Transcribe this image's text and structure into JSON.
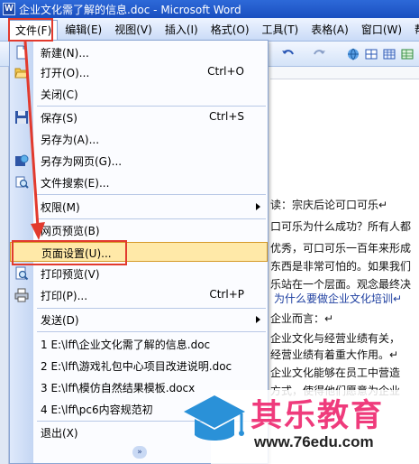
{
  "window": {
    "title": "企业文化需了解的信息.doc - Microsoft Word",
    "app_icon": "W"
  },
  "menubar": {
    "items": [
      "文件(F)",
      "编辑(E)",
      "视图(V)",
      "插入(I)",
      "格式(O)",
      "工具(T)",
      "表格(A)",
      "窗口(W)",
      "帮"
    ],
    "active_index": 0
  },
  "file_menu": {
    "items": [
      {
        "label": "新建(N)...",
        "icon": "new-doc-icon",
        "shortcut": ""
      },
      {
        "label": "打开(O)...",
        "icon": "open-folder-icon",
        "shortcut": "Ctrl+O"
      },
      {
        "label": "关闭(C)",
        "icon": "",
        "shortcut": ""
      },
      {
        "label": "保存(S)",
        "icon": "save-icon",
        "shortcut": "Ctrl+S"
      },
      {
        "label": "另存为(A)...",
        "icon": "",
        "shortcut": ""
      },
      {
        "label": "另存为网页(G)...",
        "icon": "save-webpage-icon",
        "shortcut": ""
      },
      {
        "label": "文件搜索(E)...",
        "icon": "file-search-icon",
        "shortcut": ""
      },
      {
        "label": "权限(M)",
        "icon": "",
        "shortcut": "",
        "submenu": true
      },
      {
        "label": "网页预览(B)",
        "icon": "",
        "shortcut": ""
      },
      {
        "label": "页面设置(U)...",
        "icon": "",
        "shortcut": "",
        "highlighted": true
      },
      {
        "label": "打印预览(V)",
        "icon": "print-preview-icon",
        "shortcut": ""
      },
      {
        "label": "打印(P)...",
        "icon": "print-icon",
        "shortcut": "Ctrl+P"
      },
      {
        "label": "发送(D)",
        "icon": "",
        "shortcut": "",
        "submenu": true
      },
      {
        "label": "1 E:\\lff\\企业文化需了解的信息.doc",
        "icon": "",
        "shortcut": ""
      },
      {
        "label": "2 E:\\lff\\游戏礼包中心项目改进说明.doc",
        "icon": "",
        "shortcut": ""
      },
      {
        "label": "3 E:\\lff\\模仿自然结果模板.docx",
        "icon": "",
        "shortcut": ""
      },
      {
        "label": "4 E:\\lff\\pc6内容规范初",
        "icon": "",
        "shortcut": ""
      },
      {
        "label": "退出(X)",
        "icon": "",
        "shortcut": ""
      }
    ],
    "expand_glyph": "»"
  },
  "document": {
    "lines": [
      "读：宗庆后论可口可乐↵",
      "口可乐为什么成功？所有人都",
      "优秀，可口可乐一百年来形成",
      "东西是非常可怕的。如果我们",
      "乐站在一个层面。观念最终决",
      "为什么要做企业文化培训↵",
      "企业而言：↵",
      "企业文化与经营业绩有关，",
      "经营业绩有着重大作用。↵",
      "企业文化能够在员工中营造",
      "方式，使得他们愿意为企业"
    ]
  },
  "watermark": {
    "brand": "其乐教育",
    "url": "www.76edu.com"
  },
  "colors": {
    "highlight_red": "#e23a2e",
    "menu_hover": "#ffe9a8",
    "titlebar_blue": "#2457c8",
    "brand_pink": "#ef3b7c"
  }
}
